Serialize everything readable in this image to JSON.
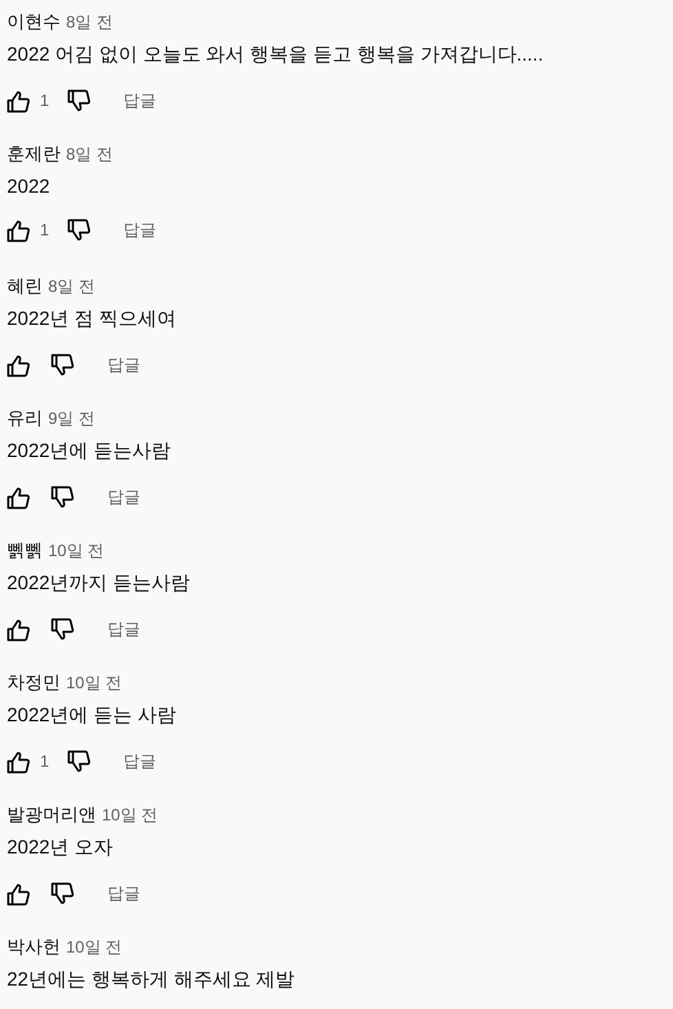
{
  "comments": [
    {
      "author": "이현수",
      "time": "8일 전",
      "text": "2022 어김 없이 오늘도 와서 행복을 듣고 행복을 가져갑니다.....",
      "likes": "1",
      "reply": "답글"
    },
    {
      "author": "훈제란",
      "time": "8일 전",
      "text": "2022",
      "likes": "1",
      "reply": "답글"
    },
    {
      "author": "혜린",
      "time": "8일 전",
      "text": "2022년 점 찍으세여",
      "reply": "답글"
    },
    {
      "author": "유리",
      "time": "9일 전",
      "text": "2022년에 듣는사람",
      "reply": "답글"
    },
    {
      "author": "뻵뻵",
      "time": "10일 전",
      "text": "2022년까지 듣는사람",
      "reply": "답글"
    },
    {
      "author": "차정민",
      "time": "10일 전",
      "text": "2022년에 듣는 사람",
      "likes": "1",
      "reply": "답글"
    },
    {
      "author": "발광머리앤",
      "time": "10일 전",
      "text": "2022년 오자",
      "reply": "답글"
    },
    {
      "author": "박사헌",
      "time": "10일 전",
      "text": "22년에는 행복하게 해주세요 제발"
    }
  ]
}
